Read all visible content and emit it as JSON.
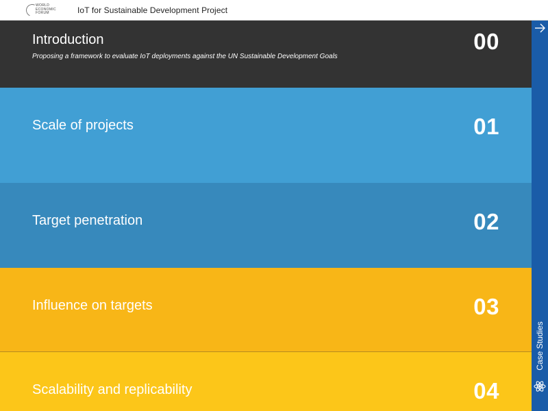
{
  "header": {
    "logo_lines": [
      "WORLD",
      "ECONOMIC",
      "FORUM"
    ],
    "title": "IoT for Sustainable Development Project"
  },
  "sections": [
    {
      "title": "Introduction",
      "subtitle": "Proposing a framework to evaluate IoT deployments against the UN Sustainable Development Goals",
      "number": "00",
      "color": "#333333"
    },
    {
      "title": "Scale of projects",
      "number": "01",
      "color": "#419fd4"
    },
    {
      "title": "Target penetration",
      "number": "02",
      "color": "#3789bc"
    },
    {
      "title": "Influence on targets",
      "number": "03",
      "color": "#f8b617"
    },
    {
      "title": "Scalability and replicability",
      "number": "04",
      "color": "#fcc619"
    }
  ],
  "sidebar": {
    "label": "Case Studies",
    "arrow_icon": "arrow-right-icon",
    "atom_icon": "atom-icon",
    "color": "#1a5ca8"
  }
}
